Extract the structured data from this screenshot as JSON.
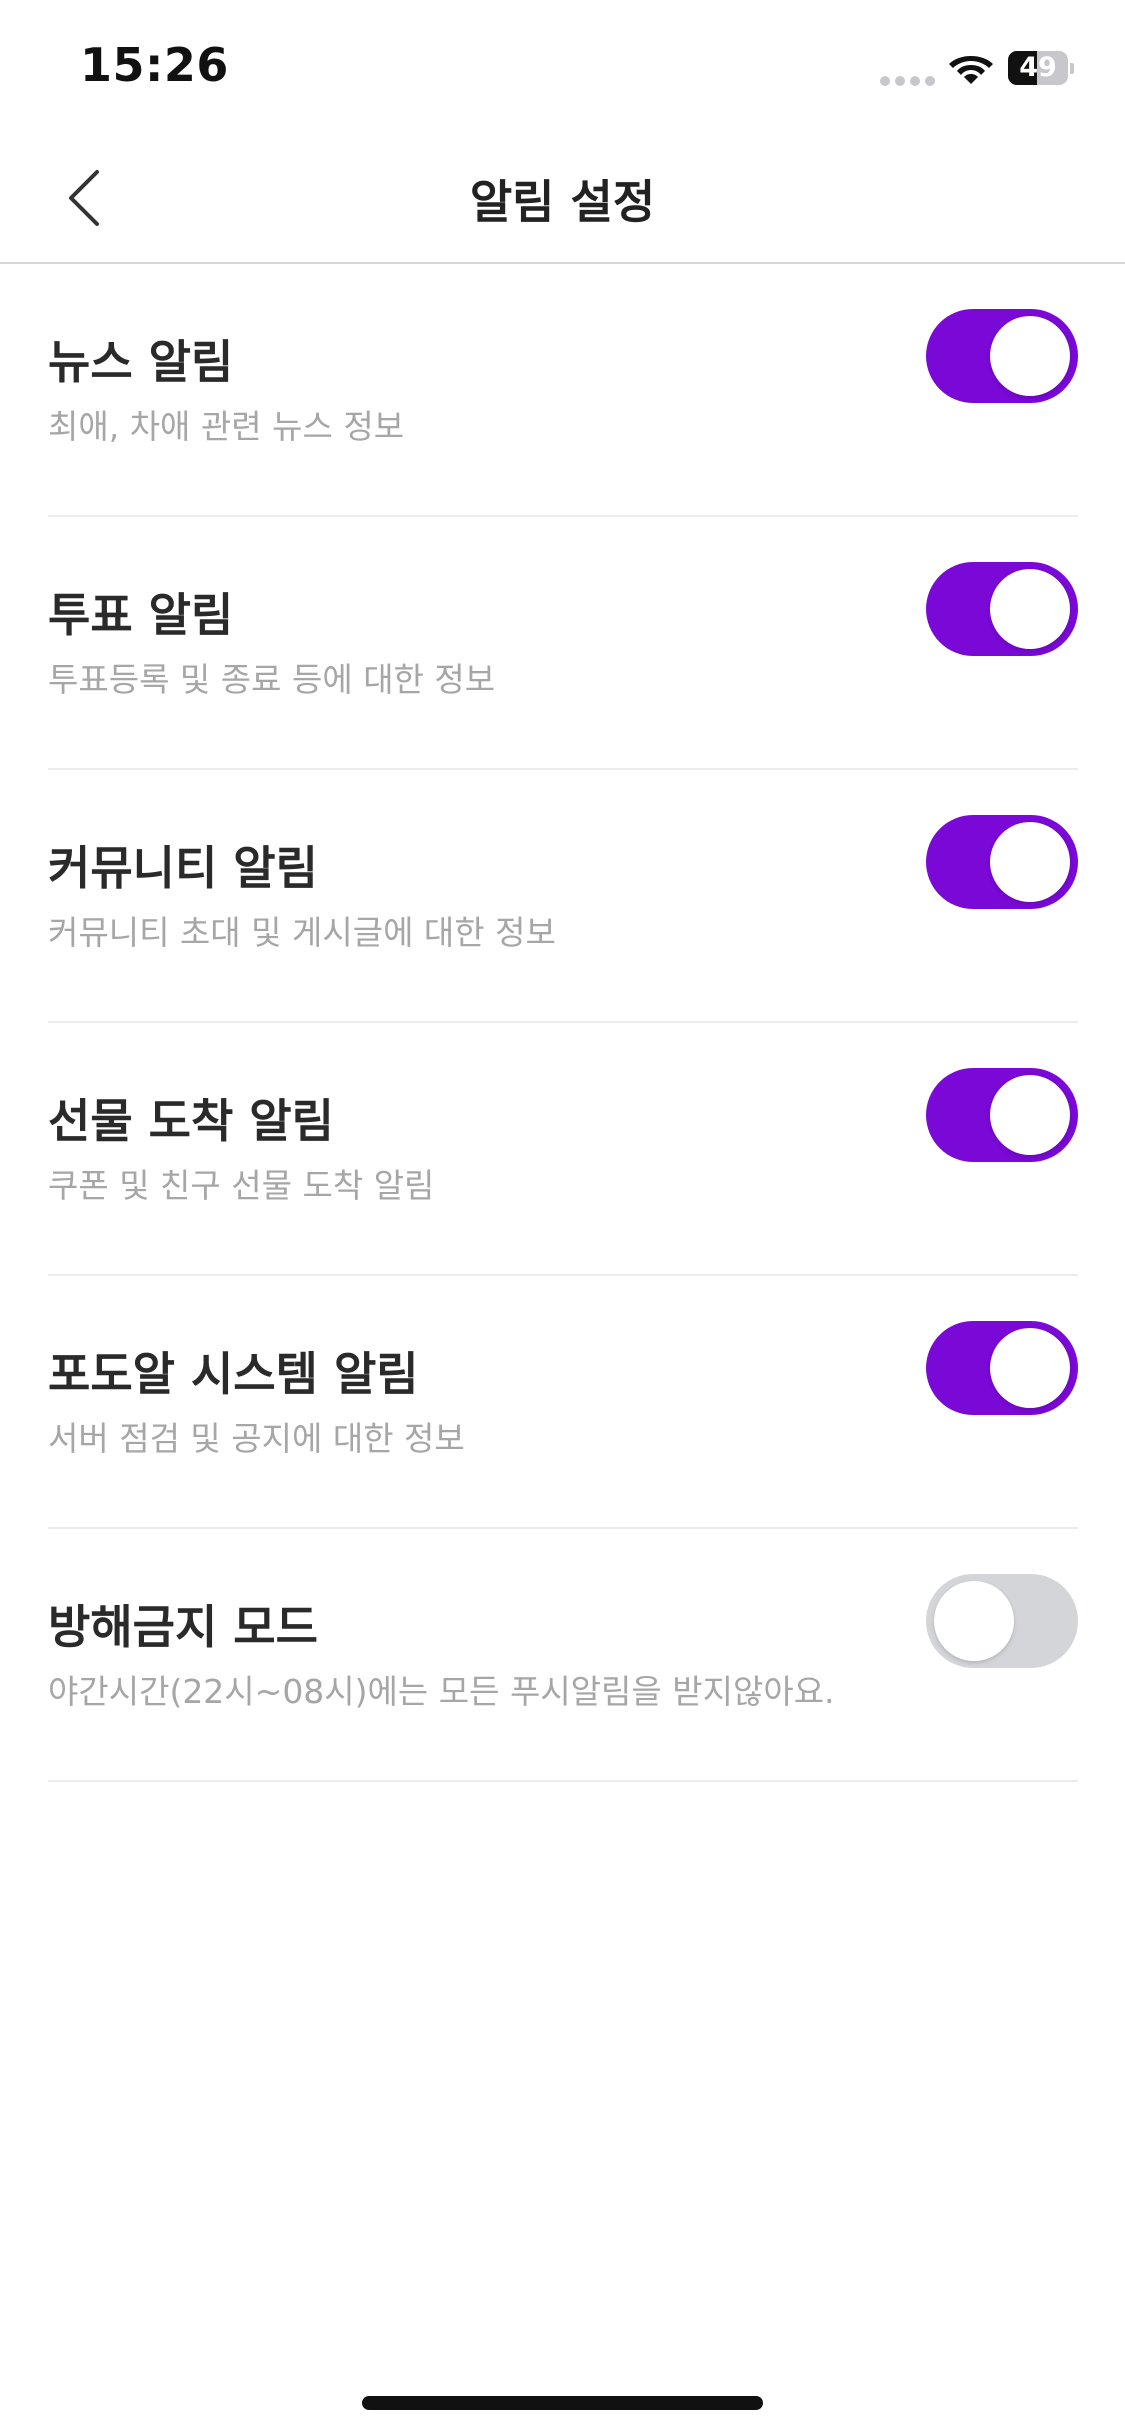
{
  "status_bar": {
    "time": "15:26",
    "battery_level": "49",
    "battery_fraction": 0.49,
    "icons": [
      "signal-dots-icon",
      "wifi-icon",
      "battery-icon"
    ]
  },
  "nav": {
    "back_icon": "chevron-left-icon",
    "title": "알림 설정"
  },
  "settings": {
    "items": [
      {
        "title": "뉴스 알림",
        "description": "최애, 차애 관련 뉴스 정보",
        "enabled": true
      },
      {
        "title": "투표 알림",
        "description": "투표등록 및 종료 등에 대한 정보",
        "enabled": true
      },
      {
        "title": "커뮤니티 알림",
        "description": "커뮤니티 초대 및 게시글에 대한 정보",
        "enabled": true
      },
      {
        "title": "선물 도착 알림",
        "description": "쿠폰 및 친구 선물 도착 알림",
        "enabled": true
      },
      {
        "title": "포도알 시스템 알림",
        "description": "서버 점검 및 공지에 대한 정보",
        "enabled": true
      },
      {
        "title": "방해금지 모드",
        "description": "야간시간(22시~08시)에는 모든 푸시알림을 받지않아요.",
        "enabled": false
      }
    ]
  },
  "colors": {
    "toggle_on": "#7a08d6",
    "toggle_off": "#d3d5d8",
    "title_text": "#2a2a2a",
    "description_text": "#a6a6a6",
    "divider": "#ececec"
  }
}
